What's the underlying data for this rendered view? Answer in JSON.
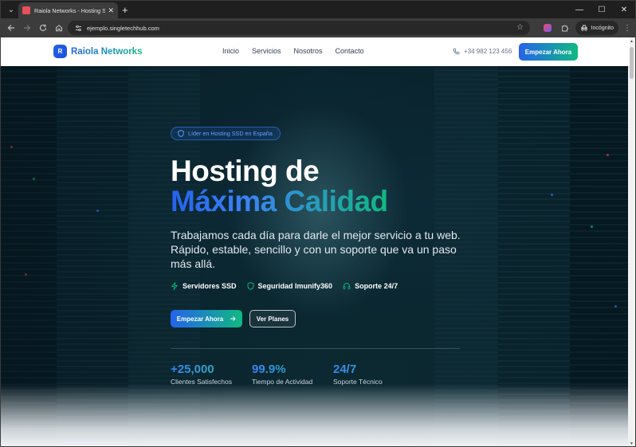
{
  "browser": {
    "tab_title": "Raiola Networks - Hosting SSD",
    "url": "ejemplo.singletechhub.com",
    "incognito_label": "Incógnito",
    "new_tab_symbol": "+",
    "menu_symbol": "⌄",
    "close_symbol": "✕",
    "controls": {
      "minimize": "—",
      "maximize": "☐",
      "close": "✕"
    }
  },
  "site": {
    "brand_logo_letter": "R",
    "brand_name": "Raiola Networks",
    "menu": [
      "Inicio",
      "Servicios",
      "Nosotros",
      "Contacto"
    ],
    "phone": "+34 982 123 456",
    "nav_cta": "Empezar Ahora"
  },
  "hero": {
    "badge": "Líder en Hosting SSD en España",
    "title_line1": "Hosting de",
    "title_line2": "Máxima Calidad",
    "lead": "Trabajamos cada día para darle el mejor servicio a tu web. Rápido, estable, sencillo y con un soporte que va un paso más allá.",
    "features": [
      {
        "icon": "bolt-icon",
        "label": "Servidores SSD"
      },
      {
        "icon": "shield-icon",
        "label": "Seguridad Imunify360"
      },
      {
        "icon": "headset-icon",
        "label": "Soporte 24/7"
      }
    ],
    "primary_button": "Empezar Ahora",
    "secondary_button": "Ver Planes",
    "stats": [
      {
        "value": "+25,000",
        "label": "Clientes Satisfechos"
      },
      {
        "value": "99.9%",
        "label": "Tiempo de Actividad"
      },
      {
        "value": "24/7",
        "label": "Soporte Técnico"
      }
    ]
  },
  "colors": {
    "accent_blue": "#2563eb",
    "accent_green": "#10b981",
    "hero_bg": "#0c2a35"
  }
}
